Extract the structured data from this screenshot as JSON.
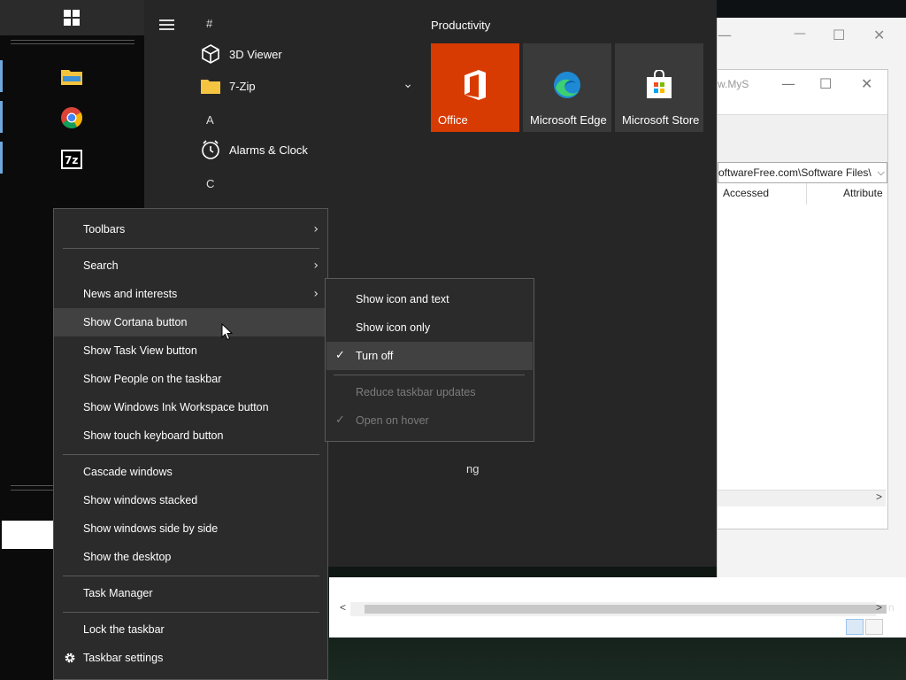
{
  "background_windows": {
    "explorer_address_fragment": "w.MyS",
    "address_path": "oftwareFree.com\\Software Files\\",
    "col_accessed": "Accessed",
    "col_attributes": "Attribute",
    "scroll_right_glyph": ">",
    "scroll_left_glyph": "<",
    "edge_letter": "n"
  },
  "start_menu": {
    "app_list": [
      {
        "label": "#"
      },
      {
        "label": "3D Viewer",
        "icon": "cube-icon"
      },
      {
        "label": "7-Zip",
        "icon": "folder-icon"
      },
      {
        "label": "A"
      },
      {
        "label": "Alarms & Clock",
        "icon": "clock-icon"
      },
      {
        "label": "C"
      }
    ],
    "group_title": "Productivity",
    "tiles": [
      {
        "label": "Office",
        "color": "#d83b01",
        "icon": "office-icon"
      },
      {
        "label": "Microsoft Edge",
        "color": "#3a3a3a",
        "icon": "edge-icon"
      },
      {
        "label": "Microsoft Store",
        "color": "#3a3a3a",
        "icon": "store-icon"
      }
    ],
    "partial_text": "ng"
  },
  "context_menu": {
    "items": [
      {
        "label": "Toolbars",
        "has_submenu": true
      },
      {
        "label": "Search",
        "has_submenu": true
      },
      {
        "label": "News and interests",
        "has_submenu": true
      },
      {
        "label": "Show Cortana button"
      },
      {
        "label": "Show Task View button"
      },
      {
        "label": "Show People on the taskbar"
      },
      {
        "label": "Show Windows Ink Workspace button"
      },
      {
        "label": "Show touch keyboard button"
      },
      {
        "label": "Cascade windows"
      },
      {
        "label": "Show windows stacked"
      },
      {
        "label": "Show windows side by side"
      },
      {
        "label": "Show the desktop"
      },
      {
        "label": "Task Manager"
      },
      {
        "label": "Lock the taskbar"
      },
      {
        "label": "Taskbar settings",
        "icon": "gear-icon"
      }
    ]
  },
  "submenu": {
    "items": [
      {
        "label": "Show icon and text"
      },
      {
        "label": "Show icon only"
      },
      {
        "label": "Turn off",
        "checked": true
      },
      {
        "label": "Reduce taskbar updates",
        "disabled": true
      },
      {
        "label": "Open on hover",
        "checked": true,
        "disabled": true
      }
    ]
  },
  "colors": {
    "menu_bg": "#2b2b2b",
    "menu_highlight": "#414141",
    "office_tile": "#d83b01"
  }
}
